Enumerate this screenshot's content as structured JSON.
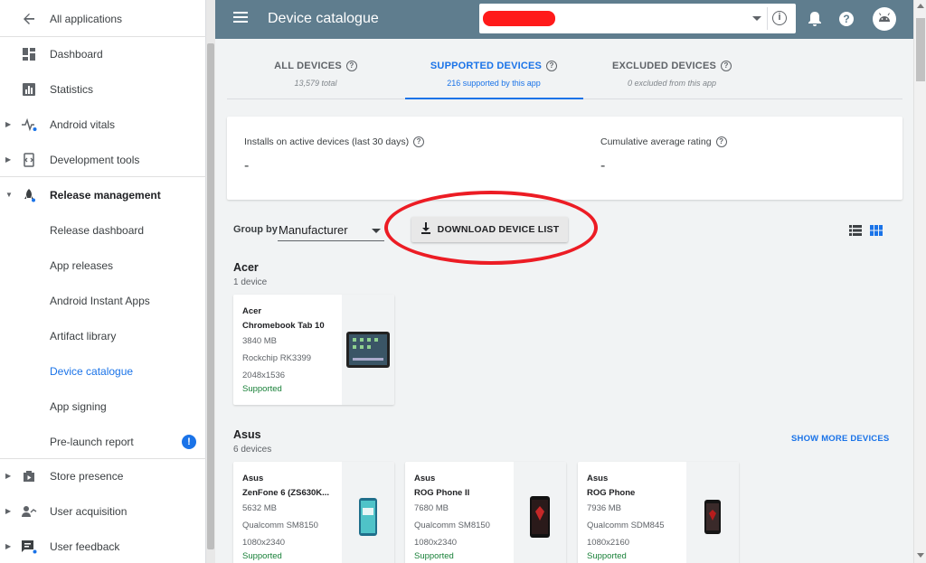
{
  "sidebar": {
    "back_label": "All applications",
    "items": [
      {
        "label": "Dashboard",
        "icon": "dashboard-icon"
      },
      {
        "label": "Statistics",
        "icon": "bar-chart-icon"
      },
      {
        "label": "Android vitals",
        "icon": "vitals-icon"
      },
      {
        "label": "Development tools",
        "icon": "dev-tools-icon"
      },
      {
        "label": "Release management",
        "icon": "rocket-icon"
      },
      {
        "label": "Release dashboard"
      },
      {
        "label": "App releases"
      },
      {
        "label": "Android Instant Apps"
      },
      {
        "label": "Artifact library"
      },
      {
        "label": "Device catalogue"
      },
      {
        "label": "App signing"
      },
      {
        "label": "Pre-launch report",
        "badge": "!"
      },
      {
        "label": "Store presence",
        "icon": "store-icon"
      },
      {
        "label": "User acquisition",
        "icon": "user-acquisition-icon"
      },
      {
        "label": "User feedback",
        "icon": "feedback-icon"
      }
    ]
  },
  "topbar": {
    "title": "Device catalogue",
    "info_glyph": "i",
    "help_glyph": "?"
  },
  "tabs": [
    {
      "label": "ALL DEVICES",
      "sub": "13,579 total"
    },
    {
      "label": "SUPPORTED DEVICES",
      "sub": "216 supported by this app"
    },
    {
      "label": "EXCLUDED DEVICES",
      "sub": "0 excluded from this app"
    }
  ],
  "stats": {
    "installs_label": "Installs on active devices (last 30 days)",
    "installs_value": "-",
    "rating_label": "Cumulative average rating",
    "rating_value": "-"
  },
  "toolbar": {
    "group_by_label": "Group by",
    "group_by_value": "Manufacturer",
    "download_label": "DOWNLOAD DEVICE LIST"
  },
  "sections": [
    {
      "title": "Acer",
      "count": "1 device"
    },
    {
      "title": "Asus",
      "count": "6 devices",
      "show_more": "SHOW MORE DEVICES"
    }
  ],
  "devices": [
    {
      "maker": "Acer",
      "model": "Chromebook Tab 10",
      "ram": "3840 MB",
      "soc": "Rockchip RK3399",
      "res": "2048x1536",
      "status": "Supported"
    },
    {
      "maker": "Asus",
      "model": "ZenFone 6 (ZS630K...",
      "ram": "5632 MB",
      "soc": "Qualcomm SM8150",
      "res": "1080x2340",
      "status": "Supported"
    },
    {
      "maker": "Asus",
      "model": "ROG Phone II",
      "ram": "7680 MB",
      "soc": "Qualcomm SM8150",
      "res": "1080x2340",
      "status": "Supported"
    },
    {
      "maker": "Asus",
      "model": "ROG Phone",
      "ram": "7936 MB",
      "soc": "Qualcomm SDM845",
      "res": "1080x2160",
      "status": "Supported"
    }
  ],
  "colors": {
    "accent": "#1a73e8",
    "topbar": "#5f7d8e",
    "supported": "#188038",
    "highlight": "#ec1c24"
  }
}
